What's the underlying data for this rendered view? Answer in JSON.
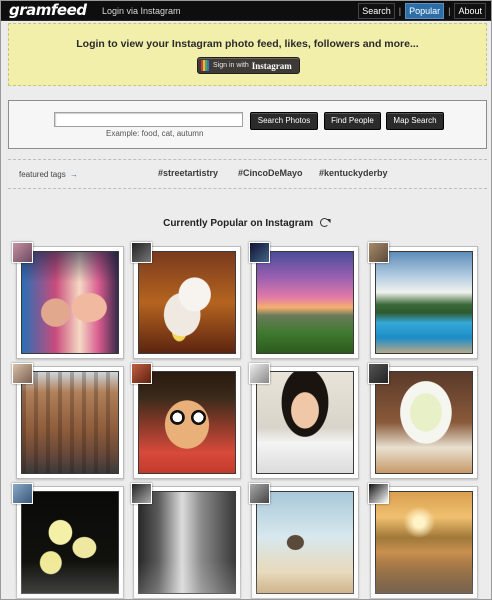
{
  "header": {
    "logo": "gramfeed",
    "login_link": "Login via Instagram",
    "nav": [
      {
        "label": "Search",
        "active": false
      },
      {
        "label": "Popular",
        "active": true
      },
      {
        "label": "About",
        "active": false
      }
    ],
    "nav_separator": "|"
  },
  "banner": {
    "text": "Login to view your Instagram photo feed, likes, followers and more...",
    "signin_label": "Sign in with",
    "signin_brand": "Instagram"
  },
  "search": {
    "input_value": "",
    "input_placeholder": "",
    "example": "Example: food, cat, autumn",
    "buttons": {
      "photos": "Search Photos",
      "people": "Find People",
      "map": "Map Search"
    }
  },
  "featured": {
    "label": "featured tags",
    "arrow": "→",
    "tags": [
      "#streetartistry",
      "#CincoDeMayo",
      "#kentuckyderby"
    ]
  },
  "popular": {
    "title": "Currently Popular on Instagram",
    "photos": [
      {
        "name": "photo-1-girls-bus",
        "desc": "two women posing in bus"
      },
      {
        "name": "photo-2-white-cat",
        "desc": "white cat on rug"
      },
      {
        "name": "photo-3-sunset-field",
        "desc": "purple sunset over grass"
      },
      {
        "name": "photo-4-pool",
        "desc": "resort swimming pool"
      },
      {
        "name": "photo-5-townhouses",
        "desc": "brick town houses"
      },
      {
        "name": "photo-6-glasses-boy",
        "desc": "boy with glasses and chopsticks"
      },
      {
        "name": "photo-7-smiling-girl",
        "desc": "smiling girl"
      },
      {
        "name": "photo-8-noodles",
        "desc": "bowl of noodles"
      },
      {
        "name": "photo-9-orchids",
        "desc": "yellow orchids"
      },
      {
        "name": "photo-10-building",
        "desc": "building reflections"
      },
      {
        "name": "photo-11-jumping-man",
        "desc": "man jumping against sky"
      },
      {
        "name": "photo-12-beach-sunset",
        "desc": "sunset beach silhouette"
      }
    ]
  },
  "colors": {
    "banner_bg": "#f1efaa",
    "nav_active": "#2e6ea8",
    "button_bg": "#2b2b2b"
  }
}
